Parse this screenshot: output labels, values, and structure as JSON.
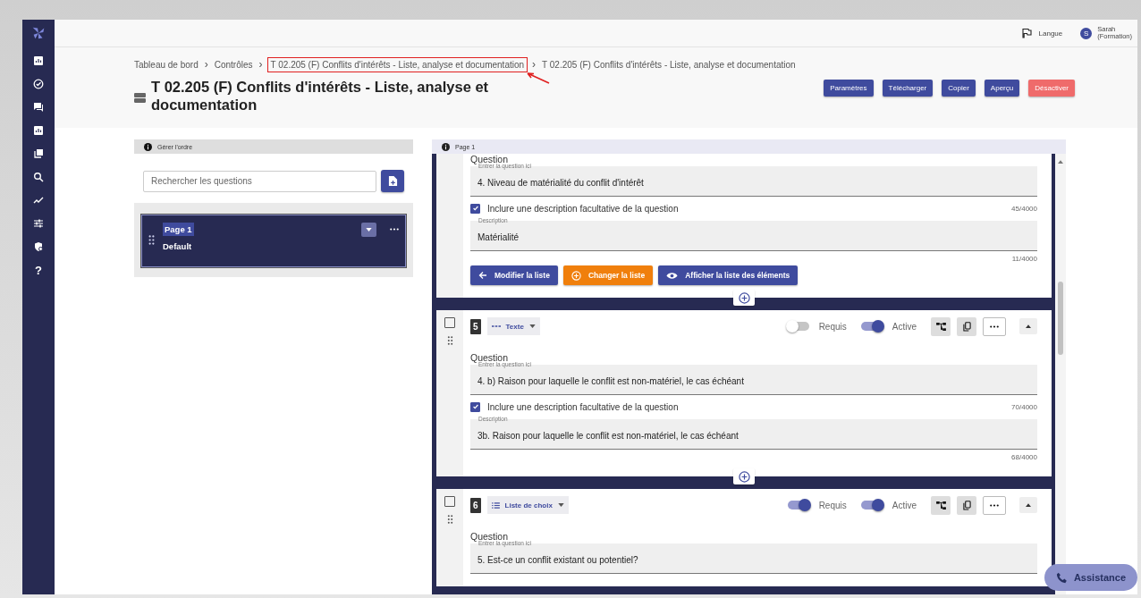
{
  "sidebar": {
    "help": "?"
  },
  "topbar": {
    "language": "Langue",
    "user": {
      "initial": "S",
      "name": "Sarah",
      "role": "(Formation)"
    }
  },
  "breadcrumb": {
    "separator": "›",
    "items": [
      {
        "label": "Tableau de bord",
        "highlighted": false
      },
      {
        "label": "Contrôles",
        "highlighted": false
      },
      {
        "label": "T 02.205 (F) Conflits d'intérêts - Liste, analyse et documentation",
        "highlighted": true
      },
      {
        "label": "T 02.205 (F) Conflits d'intérêts - Liste, analyse et documentation",
        "highlighted": false
      }
    ]
  },
  "title": "T 02.205 (F) Conflits d'intérêts - Liste, analyse et documentation",
  "actions": [
    {
      "label": "Paramètres",
      "kind": "primary"
    },
    {
      "label": "Télécharger",
      "kind": "primary"
    },
    {
      "label": "Copier",
      "kind": "primary"
    },
    {
      "label": "Aperçu",
      "kind": "primary"
    },
    {
      "label": "Désactiver",
      "kind": "danger"
    }
  ],
  "order_panel": {
    "header": "Gérer l'ordre",
    "search_placeholder": "Rechercher les questions",
    "pages": [
      {
        "title": "Page 1",
        "subtitle": "Default",
        "selected": true
      }
    ]
  },
  "page_panel": {
    "header": "Page 1",
    "questions": [
      {
        "partial": true,
        "question_label": "Question",
        "field_label": "Entrer la question ici",
        "value": "4. Niveau de matérialité du conflit d'intérêt",
        "description_option": "Inclure une description facultative de la question",
        "description_checked": true,
        "question_count": "45/4000",
        "description_label": "Description",
        "description": "Matérialité",
        "description_count": "11/4000",
        "buttons": [
          {
            "label": "Modifier la liste",
            "kind": "back"
          },
          {
            "label": "Changer la liste",
            "kind": "change"
          },
          {
            "label": "Afficher la liste des éléments",
            "kind": "view"
          }
        ]
      },
      {
        "partial": false,
        "number": "5",
        "type": {
          "label": "Texte",
          "kind": "text"
        },
        "required_label": "Requis",
        "required": false,
        "active_label": "Active",
        "active": true,
        "selected": false,
        "question_label": "Question",
        "field_label": "Entrer la question ici",
        "value": "4. b) Raison pour laquelle le conflit est non-matériel, le cas échéant",
        "description_option": "Inclure une description facultative de la question",
        "description_checked": true,
        "question_count": "70/4000",
        "description_label": "Description",
        "description": "3b. Raison pour laquelle le conflit est non-matériel, le cas échéant",
        "description_count": "68/4000"
      },
      {
        "partial": false,
        "number": "6",
        "type": {
          "label": "Liste de choix",
          "kind": "choice"
        },
        "required_label": "Requis",
        "required": true,
        "active_label": "Active",
        "active": true,
        "selected": false,
        "question_label": "Question",
        "field_label": "Entrer la question ici",
        "value": "5. Est-ce un conflit existant ou potentiel?"
      }
    ]
  },
  "assistance": "Assistance"
}
